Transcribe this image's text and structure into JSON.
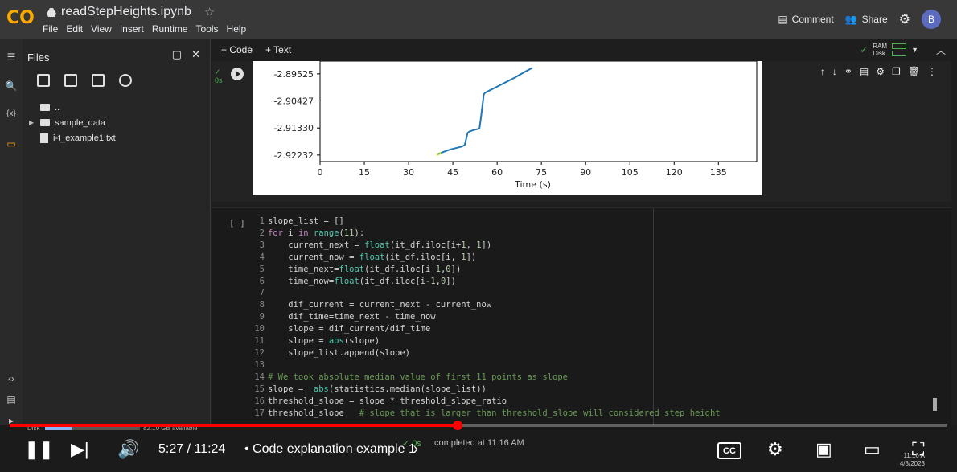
{
  "header": {
    "title": "readStepHeights.ipynb",
    "menu": [
      "File",
      "Edit",
      "View",
      "Insert",
      "Runtime",
      "Tools",
      "Help"
    ],
    "comment_label": "Comment",
    "share_label": "Share",
    "avatar_letter": "B",
    "logo_text": "CO"
  },
  "files_panel": {
    "title": "Files",
    "items": [
      {
        "name": "..",
        "type": "folder-up"
      },
      {
        "name": "sample_data",
        "type": "folder"
      },
      {
        "name": "i-t_example1.txt",
        "type": "file"
      }
    ]
  },
  "toolbar": {
    "code_label": "+ Code",
    "text_label": "+ Text",
    "ram_label": "RAM",
    "disk_label": "Disk"
  },
  "cell1": {
    "exec_time": "0s"
  },
  "chart_data": {
    "type": "line",
    "xlabel": "Time (s)",
    "ylabel": "",
    "x_ticks": [
      "0",
      "15",
      "30",
      "45",
      "60",
      "75",
      "90",
      "105",
      "120",
      "135"
    ],
    "y_ticks": [
      "-2.89525",
      "-2.90427",
      "-2.91330",
      "-2.92232"
    ],
    "xlim": [
      0,
      148
    ],
    "ylim": [
      -2.9245,
      -2.891
    ],
    "series": [
      {
        "color": "#1f77b4",
        "x": [
          40,
          42,
          44,
          46,
          48,
          49,
          49.5,
          50,
          50.5,
          52,
          54,
          54.5,
          55,
          55.5,
          56,
          58,
          60,
          63,
          66,
          69,
          72
        ],
        "y": [
          -2.922,
          -2.9212,
          -2.9205,
          -2.92,
          -2.9195,
          -2.919,
          -2.917,
          -2.915,
          -2.9145,
          -2.914,
          -2.9135,
          -2.91,
          -2.906,
          -2.902,
          -2.9015,
          -2.9005,
          -2.8995,
          -2.898,
          -2.8965,
          -2.8948,
          -2.8932
        ]
      }
    ],
    "highlight": {
      "color": "#d7e300",
      "x": [
        39.5,
        41.5
      ],
      "y": [
        -2.9222,
        -2.9215
      ]
    }
  },
  "cell2": {
    "brackets": "[ ]",
    "lines": [
      [
        [
          "tx",
          "slope_list = []"
        ]
      ],
      [
        [
          "kw",
          "for"
        ],
        [
          "tx",
          " i "
        ],
        [
          "kw",
          "in"
        ],
        [
          "tx",
          " "
        ],
        [
          "fn",
          "range"
        ],
        [
          "tx",
          "("
        ],
        [
          "num",
          "11"
        ],
        [
          "tx",
          "):"
        ]
      ],
      [
        [
          "tx",
          "    current_next = "
        ],
        [
          "fn",
          "float"
        ],
        [
          "tx",
          "(it_df.iloc[i+"
        ],
        [
          "num",
          "1"
        ],
        [
          "tx",
          ", "
        ],
        [
          "num",
          "1"
        ],
        [
          "tx",
          "])"
        ]
      ],
      [
        [
          "tx",
          "    current_now = "
        ],
        [
          "fn",
          "float"
        ],
        [
          "tx",
          "(it_df.iloc[i, "
        ],
        [
          "num",
          "1"
        ],
        [
          "tx",
          "])"
        ]
      ],
      [
        [
          "tx",
          "    time_next="
        ],
        [
          "fn",
          "float"
        ],
        [
          "tx",
          "(it_df.iloc[i+"
        ],
        [
          "num",
          "1"
        ],
        [
          "tx",
          ","
        ],
        [
          "num",
          "0"
        ],
        [
          "tx",
          "])"
        ]
      ],
      [
        [
          "tx",
          "    time_now="
        ],
        [
          "fn",
          "float"
        ],
        [
          "tx",
          "(it_df.iloc[i-"
        ],
        [
          "num",
          "1"
        ],
        [
          "tx",
          ","
        ],
        [
          "num",
          "0"
        ],
        [
          "tx",
          "])"
        ]
      ],
      [
        [
          "tx",
          ""
        ]
      ],
      [
        [
          "tx",
          "    dif_current = current_next - current_now"
        ]
      ],
      [
        [
          "tx",
          "    dif_time=time_next - time_now"
        ]
      ],
      [
        [
          "tx",
          "    slope = dif_current/dif_time"
        ]
      ],
      [
        [
          "tx",
          "    slope = "
        ],
        [
          "fn",
          "abs"
        ],
        [
          "tx",
          "(slope)"
        ]
      ],
      [
        [
          "tx",
          "    slope_list.append(slope)"
        ]
      ],
      [
        [
          "tx",
          ""
        ]
      ],
      [
        [
          "cm",
          "# We took absolute median value of first 11 points as slope"
        ]
      ],
      [
        [
          "tx",
          "slope =  "
        ],
        [
          "fn",
          "abs"
        ],
        [
          "tx",
          "(statistics.median(slope_list))"
        ]
      ],
      [
        [
          "tx",
          "threshold_slope = slope * threshold_slope_ratio"
        ]
      ],
      [
        [
          "tx",
          "threshold_slope   "
        ],
        [
          "cm",
          "# slope that is larger than threshold_slope will considered step height"
        ]
      ]
    ]
  },
  "status": {
    "disk_label": "Disk",
    "disk_avail": "82.10 GB available",
    "completed": "completed at 11:16 AM",
    "exec": "0s"
  },
  "video": {
    "time": "5:27 / 11:24",
    "chapter": "• Code explanation example 1",
    "progress": 0.478,
    "cc_label": "CC",
    "clock": "11:16 A",
    "date": "4/3/2023"
  }
}
